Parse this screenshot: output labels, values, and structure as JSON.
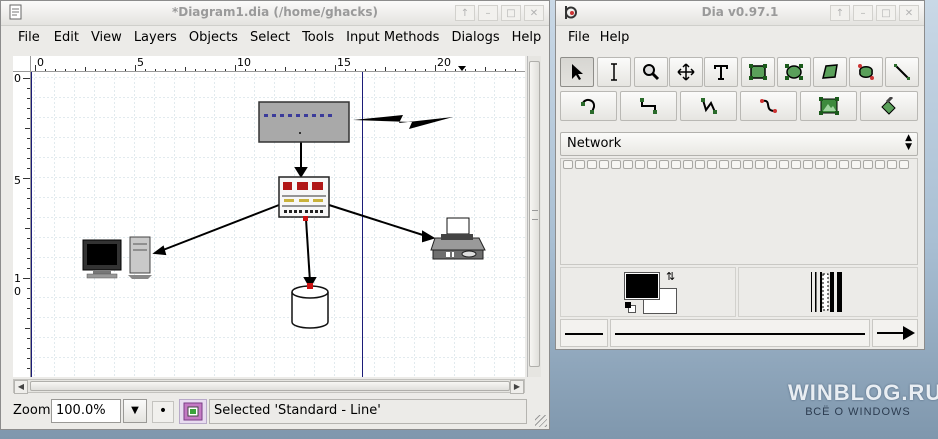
{
  "diagram_window": {
    "title": "*Diagram1.dia (/home/ghacks)",
    "menu": [
      "File",
      "Edit",
      "View",
      "Layers",
      "Objects",
      "Select",
      "Tools",
      "Input Methods",
      "Dialogs",
      "Help"
    ],
    "ruler_top": [
      "0",
      "5",
      "10",
      "15",
      "20"
    ],
    "ruler_left": [
      "0",
      "5",
      "1",
      "0"
    ],
    "zoom_label": "Zoom",
    "zoom_value": "100.0%",
    "status": "Selected 'Standard - Line'"
  },
  "toolbox_window": {
    "title": "Dia v0.97.1",
    "menu": [
      "File",
      "Help"
    ],
    "tools_row1": [
      "pointer-tool",
      "text-edit-tool",
      "magnify-tool",
      "scroll-tool",
      "text-tool",
      "box-tool",
      "ellipse-tool",
      "polygon-tool",
      "beziergon-tool",
      "line-tool"
    ],
    "tools_row2": [
      "arc-tool",
      "zigzag-line-tool",
      "polyline-tool",
      "bezier-line-tool",
      "image-tool",
      "outline-tool"
    ],
    "sheet_selected": "Network",
    "sheet_item_count": 29
  },
  "colors": {
    "grid": "#dfe8ee",
    "selection": "#0b0b8a",
    "handle": "#cc1111"
  },
  "watermark": {
    "line1": "WINBLOG.RU",
    "line2": "ВСЁ О WINDOWS"
  }
}
